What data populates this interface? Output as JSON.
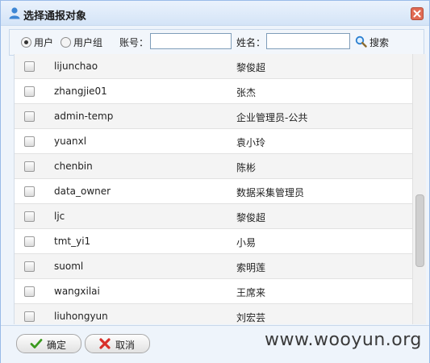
{
  "dialog": {
    "title": "选择通报对象"
  },
  "filter": {
    "options": [
      {
        "label": "用户",
        "checked": true
      },
      {
        "label": "用户组",
        "checked": false
      }
    ],
    "account_label": "账号：",
    "account_value": "",
    "name_label": "姓名：",
    "name_value": "",
    "search_label": "搜索"
  },
  "rows": [
    {
      "account": "lijunchao",
      "name": "黎俊超"
    },
    {
      "account": "zhangjie01",
      "name": "张杰"
    },
    {
      "account": "admin-temp",
      "name": "企业管理员-公共"
    },
    {
      "account": "yuanxl",
      "name": "袁小玲"
    },
    {
      "account": "chenbin",
      "name": "陈彬"
    },
    {
      "account": "data_owner",
      "name": "数据采集管理员"
    },
    {
      "account": "ljc",
      "name": "黎俊超"
    },
    {
      "account": "tmt_yi1",
      "name": "小易"
    },
    {
      "account": "suoml",
      "name": "索明莲"
    },
    {
      "account": "wangxilai",
      "name": "王席来"
    },
    {
      "account": "liuhongyun",
      "name": "刘宏芸"
    }
  ],
  "footer": {
    "ok_label": "确定",
    "cancel_label": "取消"
  },
  "watermark": "www.wooyun.org",
  "colors": {
    "title_bar": "#d4e4f7",
    "border": "#99bbe8",
    "row_alt": "#f4f4f4"
  }
}
